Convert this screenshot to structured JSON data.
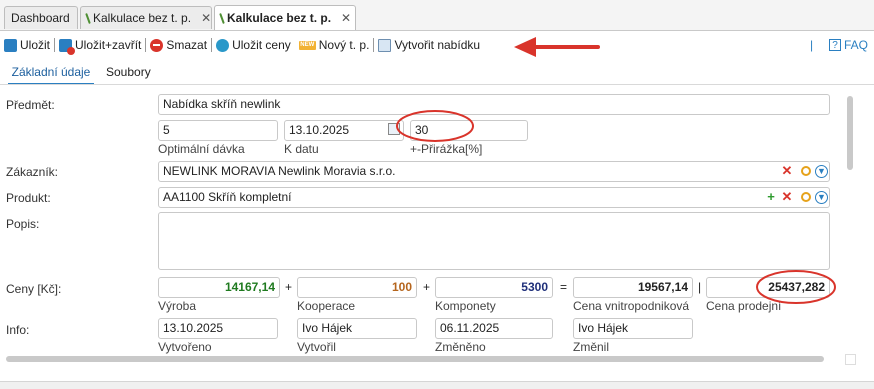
{
  "tabs": [
    {
      "label": "Dashboard"
    },
    {
      "label": "Kalkulace bez t. p."
    },
    {
      "label": "Kalkulace bez t. p."
    }
  ],
  "toolbar": {
    "save": "Uložit",
    "save_close": "Uložit+zavřít",
    "delete": "Smazat",
    "save_prices": "Uložit ceny",
    "new": "Nový t. p.",
    "new_icon_text": "NEW",
    "create_offer": "Vytvořit nabídku",
    "faq": "FAQ",
    "faq_icon": "?"
  },
  "subtabs": {
    "basic": "Základní údaje",
    "files": "Soubory"
  },
  "form": {
    "subject_label": "Předmět:",
    "subject": "Nabídka skříň newlink",
    "batch": "5",
    "batch_label": "Optimální dávka",
    "date": "13.10.2025",
    "date_label": "K datu",
    "surcharge": "30",
    "surcharge_label": "+-Přirážka[%]",
    "customer_label": "Zákazník:",
    "customer": "NEWLINK MORAVIA Newlink Moravia s.r.o.",
    "product_label": "Produkt:",
    "product": "AA1100 Skříň kompletní",
    "description_label": "Popis:",
    "description": "",
    "prices_label": "Ceny [Kč]:",
    "production": "14167,14",
    "production_label": "Výroba",
    "cooperation": "100",
    "cooperation_label": "Kooperace",
    "components": "5300",
    "components_label": "Komponety",
    "internal_price": "19567,14",
    "internal_price_label": "Cena vnitropodniková",
    "sale_price": "25437,282",
    "sale_price_label": "Cena prodejní",
    "info_label": "Info:",
    "created": "13.10.2025",
    "created_label": "Vytvořeno",
    "created_by": "Ivo Hájek",
    "created_by_label": "Vytvořil",
    "changed": "06.11.2025",
    "changed_label": "Změněno",
    "changed_by": "Ivo Hájek",
    "changed_by_label": "Změnil",
    "op_plus1": "+",
    "op_plus2": "+",
    "op_eq": "=",
    "op_bar": "|"
  },
  "colors": {
    "production": "#1f7a1f",
    "cooperation": "#b5651d",
    "components": "#1f2f7a",
    "annotation": "#d9342b"
  }
}
